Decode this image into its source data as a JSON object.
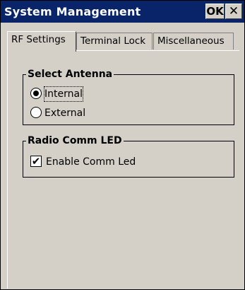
{
  "window": {
    "title": "System Management",
    "ok_label": "OK",
    "close_label": "✕"
  },
  "tabs": [
    {
      "label": "RF Settings",
      "active": true
    },
    {
      "label": "Terminal Lock",
      "active": false
    },
    {
      "label": "Miscellaneous",
      "active": false
    }
  ],
  "select_antenna": {
    "label": "Select Antenna",
    "options": [
      {
        "label": "Internal",
        "selected": true
      },
      {
        "label": "External",
        "selected": false
      }
    ]
  },
  "radio_comm_led": {
    "label": "Radio Comm LED",
    "enable_label": "Enable Comm Led",
    "checked": true,
    "check_glyph": "✔"
  }
}
